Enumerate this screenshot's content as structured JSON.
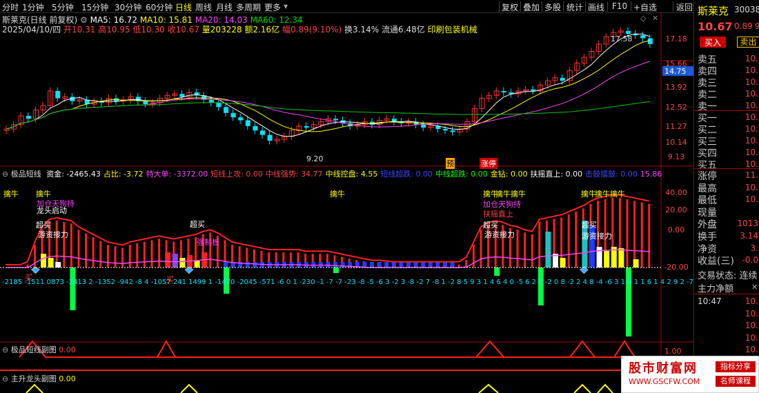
{
  "toolbar": {
    "periods": [
      "分时",
      "1分钟",
      "5分钟",
      "15分钟",
      "30分钟",
      "60分钟",
      "日线",
      "周线",
      "月线",
      "多周期",
      "更多"
    ],
    "active_period": "日线",
    "right_buttons": [
      "复权",
      "叠加",
      "多股",
      "统计",
      "画线",
      "F10",
      "+自选",
      "返回"
    ]
  },
  "stock": {
    "name": "斯莱克",
    "code": "300382",
    "subtitle": "斯莱克(日线 前复权)",
    "price": "10.67",
    "change": "0.89",
    "pct": "9"
  },
  "ma_line": {
    "ma5": "MA5: 16.72",
    "ma10": "MA10: 15.81",
    "ma20": "MA20: 14.03",
    "ma60": "MA60: 12.34"
  },
  "ohlc_line": {
    "date": "2025/04/10/四",
    "open": "开10.31",
    "high": "高10.95",
    "low": "低10.30",
    "close": "收10.67",
    "volume": "量203228",
    "amount": "额2.16亿",
    "range": "幅0.89(9.10%)",
    "turnover": "换3.14%",
    "float": "流通6.48亿",
    "industry": "印刷包装机械"
  },
  "price_axis": [
    "17.18",
    "15.66",
    "13.92",
    "12.52",
    "11.27",
    "10.14",
    "9.13"
  ],
  "price_marker": "14.75",
  "price_annotations": {
    "high": "17.58",
    "low": "9.20",
    "tag1": "预",
    "tag2": "涨停"
  },
  "indicator1": {
    "title": "极品短线",
    "values": [
      {
        "t": "资金: -2465.43",
        "c": "#ffffff"
      },
      {
        "t": "占比: -3.72",
        "c": "#ffff00"
      },
      {
        "t": "特大单: -3372.00",
        "c": "#ff44ff"
      },
      {
        "t": "短线上攻: 0.00",
        "c": "#ff4444"
      },
      {
        "t": "中线强势: 34.77",
        "c": "#ff4444"
      },
      {
        "t": "中线控盘: 4.55",
        "c": "#ffff00"
      },
      {
        "t": "短线超跌: 0.00",
        "c": "#4444ff"
      },
      {
        "t": "中线超跌: 0.00",
        "c": "#00ff00"
      },
      {
        "t": "金钻: 0.00",
        "c": "#ffff00"
      },
      {
        "t": "扶摇直上: 0.00",
        "c": "#ffffff"
      },
      {
        "t": "击鼓擂鼓: 0.00",
        "c": "#4444ff"
      },
      {
        "t": "15.86",
        "c": "#ff44ff"
      }
    ],
    "axis": [
      "40.00",
      "20.00",
      "0.00",
      "-20.00"
    ],
    "labels": [
      {
        "t": "擒牛",
        "c": "#ffff00"
      },
      {
        "t": "擒牛",
        "c": "#ffff00"
      },
      {
        "t": "擒牛",
        "c": "#ffff00"
      },
      {
        "t": "擒牛",
        "c": "#ffff00"
      },
      {
        "t": "加仓天狗持",
        "c": "#ff44ff"
      },
      {
        "t": "龙头启动",
        "c": "#ffffff"
      },
      {
        "t": "超买",
        "c": "#ffffff"
      },
      {
        "t": "游资接力",
        "c": "#ffffff"
      },
      {
        "t": "超买",
        "c": "#ffffff"
      },
      {
        "t": "强制板",
        "c": "#ff44ff"
      },
      {
        "t": "擒牛",
        "c": "#ffff00"
      },
      {
        "t": "擒牛擒牛",
        "c": "#ffff00"
      },
      {
        "t": "加仓天狗持",
        "c": "#ff44ff"
      },
      {
        "t": "扶摇直上",
        "c": "#ff4444"
      },
      {
        "t": "超买",
        "c": "#ffffff"
      },
      {
        "t": "游资接力",
        "c": "#ffffff"
      },
      {
        "t": "擒牛擒牛",
        "c": "#ffff00"
      },
      {
        "t": "超买",
        "c": "#ffffff"
      },
      {
        "t": "游资接力",
        "c": "#ffffff"
      },
      {
        "t": "买",
        "c": "#ff4444"
      },
      {
        "t": "买",
        "c": "#ff4444"
      }
    ]
  },
  "indicator2": {
    "title": "极品短线副图",
    "value": "0.00",
    "axis": "1.00"
  },
  "indicator3": {
    "title": "主升龙头副图",
    "value": "0.00"
  },
  "sidebar": {
    "buy_label": "买入",
    "sell_label": "卖出",
    "book": [
      {
        "label": "卖五",
        "val": "10."
      },
      {
        "label": "卖四",
        "val": "10."
      },
      {
        "label": "卖三",
        "val": "10."
      },
      {
        "label": "卖二",
        "val": "10."
      },
      {
        "label": "卖一",
        "val": "10."
      },
      {
        "label": "买一",
        "val": "10."
      },
      {
        "label": "买二",
        "val": "10."
      },
      {
        "label": "买三",
        "val": "10."
      },
      {
        "label": "买四",
        "val": "10."
      },
      {
        "label": "买五",
        "val": "10."
      }
    ],
    "stats": [
      {
        "label": "涨停",
        "val": "11."
      },
      {
        "label": "最高",
        "val": "10."
      },
      {
        "label": "最低",
        "val": "10."
      },
      {
        "label": "现量",
        "val": ""
      },
      {
        "label": "外盘",
        "val": "1013"
      },
      {
        "label": "换手",
        "val": "3.14"
      },
      {
        "label": "净资",
        "val": "3."
      },
      {
        "label": "收益(三)",
        "val": "-0.0"
      }
    ],
    "trade_status": "交易状态: 连续",
    "net_inflow": "主力净额",
    "ticks": [
      {
        "time": "10:47",
        "val": "10."
      },
      {
        "time": "",
        "val": "10."
      },
      {
        "time": "",
        "val": "10."
      },
      {
        "time": "",
        "val": "10."
      },
      {
        "time": "",
        "val": "10."
      },
      {
        "time": "10:48",
        "val": "10."
      }
    ]
  },
  "watermark": {
    "title": "股市财富网",
    "url": "WWW.GSCFW.COM",
    "tag1": "指标分享",
    "tag2": "名师课程"
  }
}
